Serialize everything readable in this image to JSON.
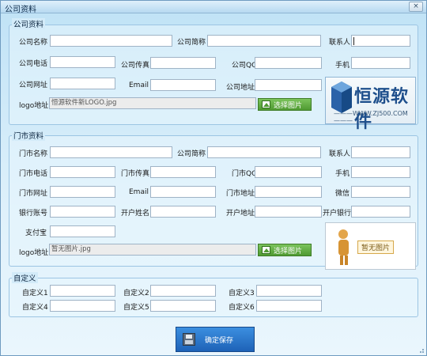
{
  "window": {
    "title": "公司资料",
    "close_glyph": "×"
  },
  "company": {
    "legend": "公司资料",
    "name_label": "公司名称",
    "short_label": "公司简称",
    "contact_label": "联系人",
    "phone_label": "公司电话",
    "fax_label": "公司传真",
    "qq_label": "公司QQ",
    "mobile_label": "手机",
    "website_label": "公司网址",
    "email_label": "Email",
    "address_label": "公司地址",
    "logo_label": "logo地址",
    "logo_value": "恒源软件新LOGO.jpg",
    "pick_label": "选择图片",
    "logo_name": "恒源软件",
    "logo_url": "———WWW.ZJ500.COM———"
  },
  "shop": {
    "legend": "门市资料",
    "name_label": "门市名称",
    "short_label": "公司简称",
    "contact_label": "联系人",
    "phone_label": "门市电话",
    "fax_label": "门市传真",
    "qq_label": "门市QQ",
    "mobile_label": "手机",
    "website_label": "门市网址",
    "email_label": "Email",
    "address_label": "门市地址",
    "wechat_label": "微信",
    "account_label": "银行账号",
    "holder_label": "开户姓名",
    "open_address_label": "开户地址",
    "bank_label": "开户银行",
    "alipay_label": "支付宝",
    "logo_label": "logo地址",
    "logo_value": "暂无图片.jpg",
    "pick_label": "选择图片",
    "nopic_label": "暂无图片"
  },
  "custom": {
    "legend": "自定义",
    "labels": [
      "自定义1",
      "自定义2",
      "自定义3",
      "自定义4",
      "自定义5",
      "自定义6"
    ]
  },
  "save": {
    "label": "确定保存"
  },
  "icons": {
    "close": "close-icon",
    "pick": "image-icon",
    "save": "floppy-disk-icon"
  }
}
